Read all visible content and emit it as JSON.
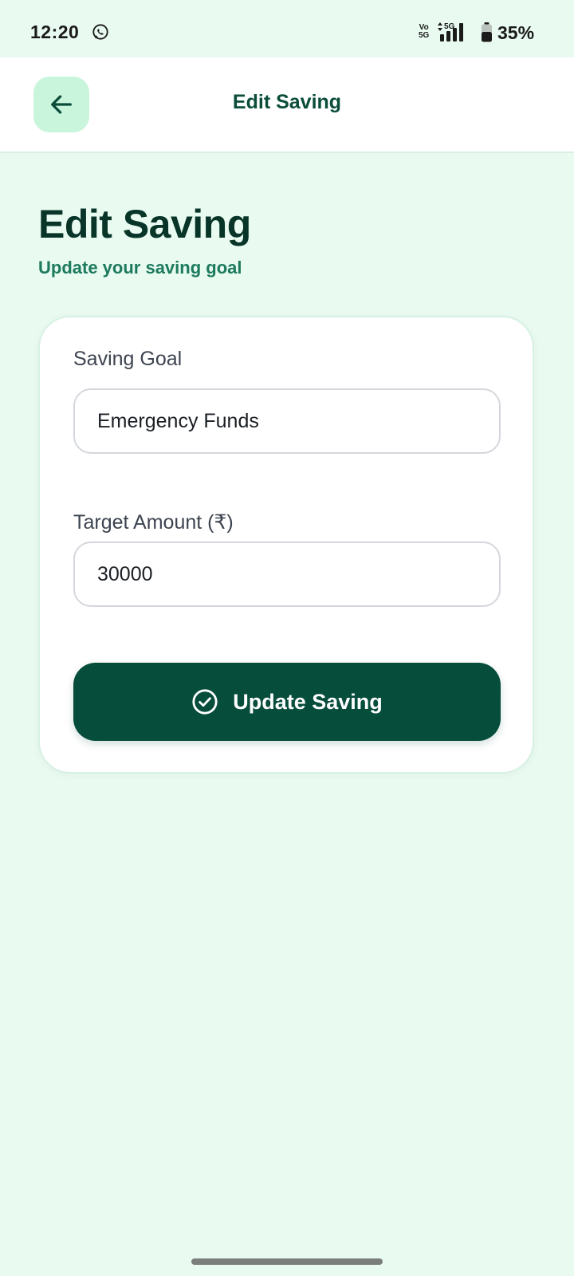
{
  "status_bar": {
    "time": "12:20",
    "network_top": "Vo",
    "network_bottom": "5G",
    "signal_label": "5G",
    "battery": "35%"
  },
  "app_bar": {
    "title": "Edit Saving",
    "back_icon": "arrow-left-icon"
  },
  "header": {
    "title": "Edit Saving",
    "subtitle": "Update your saving goal"
  },
  "form": {
    "goal_label": "Saving Goal",
    "goal_value": "Emergency Funds",
    "amount_label": "Target Amount (₹)",
    "amount_value": "30000",
    "submit_label": "Update Saving",
    "submit_icon": "check-circle-icon"
  },
  "colors": {
    "background": "#e9faf1",
    "primary": "#064d3c",
    "accent_light": "#c9f5dd",
    "subtitle": "#1c7a5d"
  }
}
